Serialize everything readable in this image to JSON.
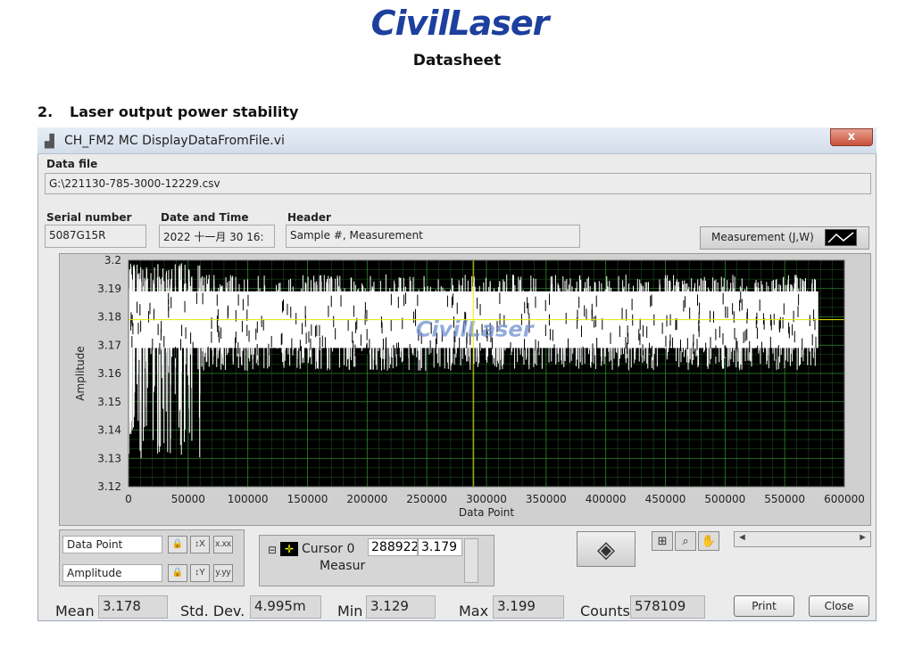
{
  "header": {
    "logo": "CivilLaser",
    "doc_title": "Datasheet",
    "section_number": "2.",
    "section_title": "Laser output power stability"
  },
  "window": {
    "title": "CH_FM2 MC DisplayDataFromFile.vi",
    "close_label": "x"
  },
  "data_file": {
    "label": "Data file",
    "value": "G:\\221130-785-3000-12229.csv"
  },
  "serial": {
    "label": "Serial number",
    "value": "5087G15R"
  },
  "datetime": {
    "label": "Date and Time",
    "value": "2022 十一月 30 16:"
  },
  "header_field": {
    "label": "Header",
    "value": "Sample #, Measurement"
  },
  "legend": {
    "label": "Measurement (J,W)"
  },
  "chart_data": {
    "type": "line",
    "ylabel": "Amplitude",
    "xlabel": "Data Point",
    "watermark": "CivilLaser",
    "xlim": [
      0,
      600000
    ],
    "ylim": [
      3.12,
      3.2
    ],
    "x_ticks": [
      "0",
      "50000",
      "100000",
      "150000",
      "200000",
      "250000",
      "300000",
      "350000",
      "400000",
      "450000",
      "500000",
      "550000",
      "600000"
    ],
    "y_ticks": [
      "3.2",
      "3.19",
      "3.18",
      "3.17",
      "3.16",
      "3.15",
      "3.14",
      "3.13",
      "3.12"
    ],
    "cursor_x": 288922,
    "cursor_y": 3.179,
    "series": [
      {
        "name": "Measurement (J,W)",
        "color": "#ffffff",
        "band_main": [
          3.169,
          3.189
        ],
        "x_max": 578109,
        "min_value": 3.129,
        "max_value": 3.199
      }
    ],
    "grid": true,
    "background": "#000000",
    "grid_color": "#2f8a2f",
    "cursor_color": "#e8e800"
  },
  "controls": {
    "x_scale_label": "Data Point",
    "y_scale_label": "Amplitude",
    "cursor_name": "Cursor 0",
    "cursor_sub": "Measur",
    "cursor_x": "288922",
    "cursor_y": "3.179"
  },
  "stats": {
    "mean_label": "Mean",
    "mean_value": "3.178",
    "std_label": "Std. Dev.",
    "std_value": "4.995m",
    "min_label": "Min",
    "min_value": "3.129",
    "max_label": "Max",
    "max_value": "3.199",
    "counts_label": "Counts",
    "counts_value": "578109"
  },
  "buttons": {
    "print": "Print",
    "close": "Close"
  },
  "icons": {
    "vi": "vi-file-icon",
    "lock": "lock-icon",
    "zoom": "zoom-icon",
    "hand": "pan-hand-icon",
    "crosshair": "crosshair-icon",
    "nav": "cursor-move-icon"
  }
}
